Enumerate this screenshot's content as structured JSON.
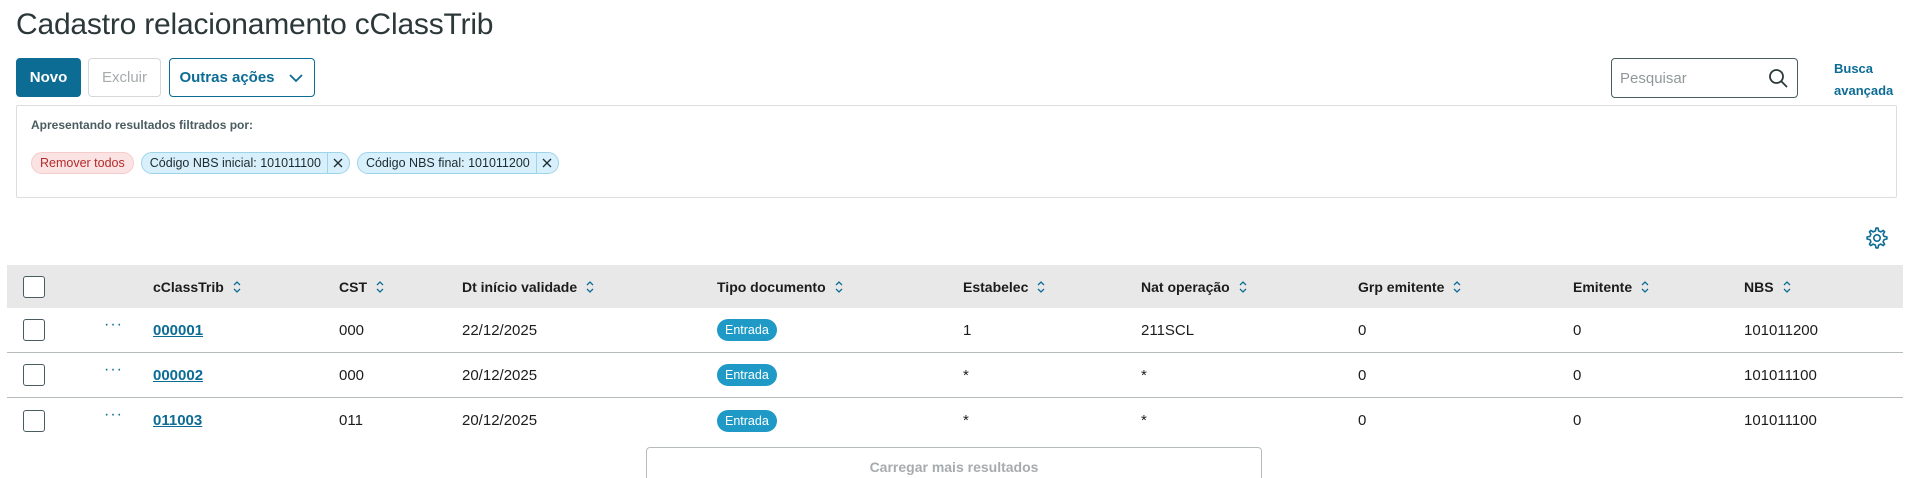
{
  "page": {
    "title": "Cadastro relacionamento cClassTrib"
  },
  "toolbar": {
    "new_label": "Novo",
    "delete_label": "Excluir",
    "more_actions_label": "Outras ações"
  },
  "search": {
    "placeholder": "Pesquisar",
    "advanced_label": "Busca avançada"
  },
  "filters": {
    "label": "Apresentando resultados filtrados por:",
    "remove_all_label": "Remover todos",
    "chips": [
      {
        "label": "Código NBS inicial: 101011100"
      },
      {
        "label": "Código NBS final: 101011200"
      }
    ]
  },
  "table": {
    "columns": [
      "cClassTrib",
      "CST",
      "Dt início validade",
      "Tipo documento",
      "Estabelec",
      "Nat operação",
      "Grp emitente",
      "Emitente",
      "NBS"
    ],
    "rows": [
      {
        "cclasstrib": "000001",
        "cst": "000",
        "dt_inicio": "22/12/2025",
        "tipo_doc": "Entrada",
        "estabelec": "1",
        "nat_operacao": "211SCL",
        "grp_emitente": "0",
        "emitente": "0",
        "nbs": "101011200",
        "actions": "···"
      },
      {
        "cclasstrib": "000002",
        "cst": "000",
        "dt_inicio": "20/12/2025",
        "tipo_doc": "Entrada",
        "estabelec": "*",
        "nat_operacao": "*",
        "grp_emitente": "0",
        "emitente": "0",
        "nbs": "101011100",
        "actions": "···"
      },
      {
        "cclasstrib": "011003",
        "cst": "011",
        "dt_inicio": "20/12/2025",
        "tipo_doc": "Entrada",
        "estabelec": "*",
        "nat_operacao": "*",
        "grp_emitente": "0",
        "emitente": "0",
        "nbs": "101011100",
        "actions": "···"
      }
    ],
    "load_more_label": "Carregar mais resultados"
  },
  "colors": {
    "primary": "#0c6c94",
    "badge": "#1f9ac7",
    "remove_chip": "#fbe3e3",
    "filter_chip": "#d8f0fb"
  },
  "icons": [
    "chevron-down-icon",
    "search-icon",
    "close-icon",
    "gear-icon",
    "sort-icon",
    "more-dots-icon"
  ]
}
